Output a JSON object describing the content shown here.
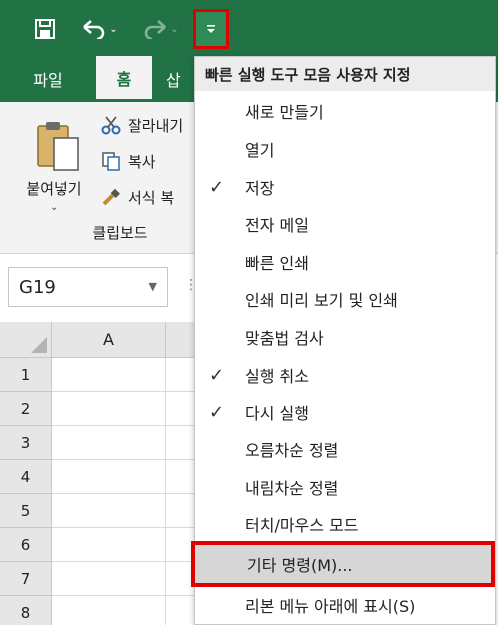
{
  "colors": {
    "excel_green": "#217346",
    "highlight_red": "#e00000"
  },
  "qat": {
    "save_icon": "save-icon",
    "undo_icon": "undo-icon",
    "redo_icon": "redo-icon",
    "customize_icon": "customize-qat-icon"
  },
  "tabs": {
    "file": "파일",
    "home": "홈",
    "insert": "삽"
  },
  "clipboard": {
    "paste": "붙여넣기",
    "cut": "잘라내기",
    "copy": "복사",
    "format_painter": "서식 복",
    "group_label": "클립보드"
  },
  "namebox": {
    "value": "G19"
  },
  "grid": {
    "column_a": "A",
    "rows": [
      "1",
      "2",
      "3",
      "4",
      "5",
      "6",
      "7",
      "8"
    ]
  },
  "menu": {
    "header": "빠른 실행 도구 모음 사용자 지정",
    "items": [
      {
        "label": "새로 만들기",
        "checked": false
      },
      {
        "label": "열기",
        "checked": false
      },
      {
        "label": "저장",
        "checked": true
      },
      {
        "label": "전자 메일",
        "checked": false
      },
      {
        "label": "빠른 인쇄",
        "checked": false
      },
      {
        "label": "인쇄 미리 보기 및 인쇄",
        "checked": false
      },
      {
        "label": "맞춤법 검사",
        "checked": false
      },
      {
        "label": "실행 취소",
        "checked": true
      },
      {
        "label": "다시 실행",
        "checked": true
      },
      {
        "label": "오름차순 정렬",
        "checked": false
      },
      {
        "label": "내림차순 정렬",
        "checked": false
      },
      {
        "label": "터치/마우스 모드",
        "checked": false
      }
    ],
    "more_commands": "기타 명령(M)...",
    "show_below_ribbon": "리본 메뉴 아래에 표시(S)",
    "check_glyph": "✓"
  }
}
